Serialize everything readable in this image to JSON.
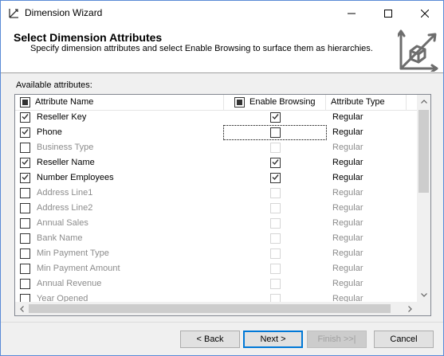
{
  "window": {
    "title": "Dimension Wizard"
  },
  "header": {
    "title": "Select Dimension Attributes",
    "subtitle": "Specify dimension attributes and select Enable Browsing to surface them as hierarchies."
  },
  "available_label": "Available attributes:",
  "columns": {
    "name": "Attribute Name",
    "browsing": "Enable Browsing",
    "type": "Attribute Type"
  },
  "header_checks": {
    "select_all": "indeterminate",
    "browsing_all": "indeterminate"
  },
  "rows": [
    {
      "name": "Reseller Key",
      "selected": true,
      "browsing": true,
      "type": "Regular",
      "enabled": true
    },
    {
      "name": "Phone",
      "selected": true,
      "browsing": false,
      "type": "Regular",
      "enabled": true,
      "focused": true
    },
    {
      "name": "Business Type",
      "selected": false,
      "browsing": false,
      "type": "Regular",
      "enabled": false
    },
    {
      "name": "Reseller Name",
      "selected": true,
      "browsing": true,
      "type": "Regular",
      "enabled": true
    },
    {
      "name": "Number Employees",
      "selected": true,
      "browsing": true,
      "type": "Regular",
      "enabled": true
    },
    {
      "name": "Address Line1",
      "selected": false,
      "browsing": false,
      "type": "Regular",
      "enabled": false
    },
    {
      "name": "Address Line2",
      "selected": false,
      "browsing": false,
      "type": "Regular",
      "enabled": false
    },
    {
      "name": "Annual Sales",
      "selected": false,
      "browsing": false,
      "type": "Regular",
      "enabled": false
    },
    {
      "name": "Bank Name",
      "selected": false,
      "browsing": false,
      "type": "Regular",
      "enabled": false
    },
    {
      "name": "Min Payment Type",
      "selected": false,
      "browsing": false,
      "type": "Regular",
      "enabled": false
    },
    {
      "name": "Min Payment Amount",
      "selected": false,
      "browsing": false,
      "type": "Regular",
      "enabled": false
    },
    {
      "name": "Annual Revenue",
      "selected": false,
      "browsing": false,
      "type": "Regular",
      "enabled": false
    },
    {
      "name": "Year Opened",
      "selected": false,
      "browsing": false,
      "type": "Regular",
      "enabled": false
    }
  ],
  "buttons": {
    "back": "< Back",
    "next": "Next >",
    "finish": "Finish >>|",
    "cancel": "Cancel"
  },
  "icons": {
    "app": "dimension-wizard-icon",
    "minimize": "minimize-icon",
    "maximize": "maximize-icon",
    "close": "close-icon",
    "header": "cube-axes-icon"
  }
}
